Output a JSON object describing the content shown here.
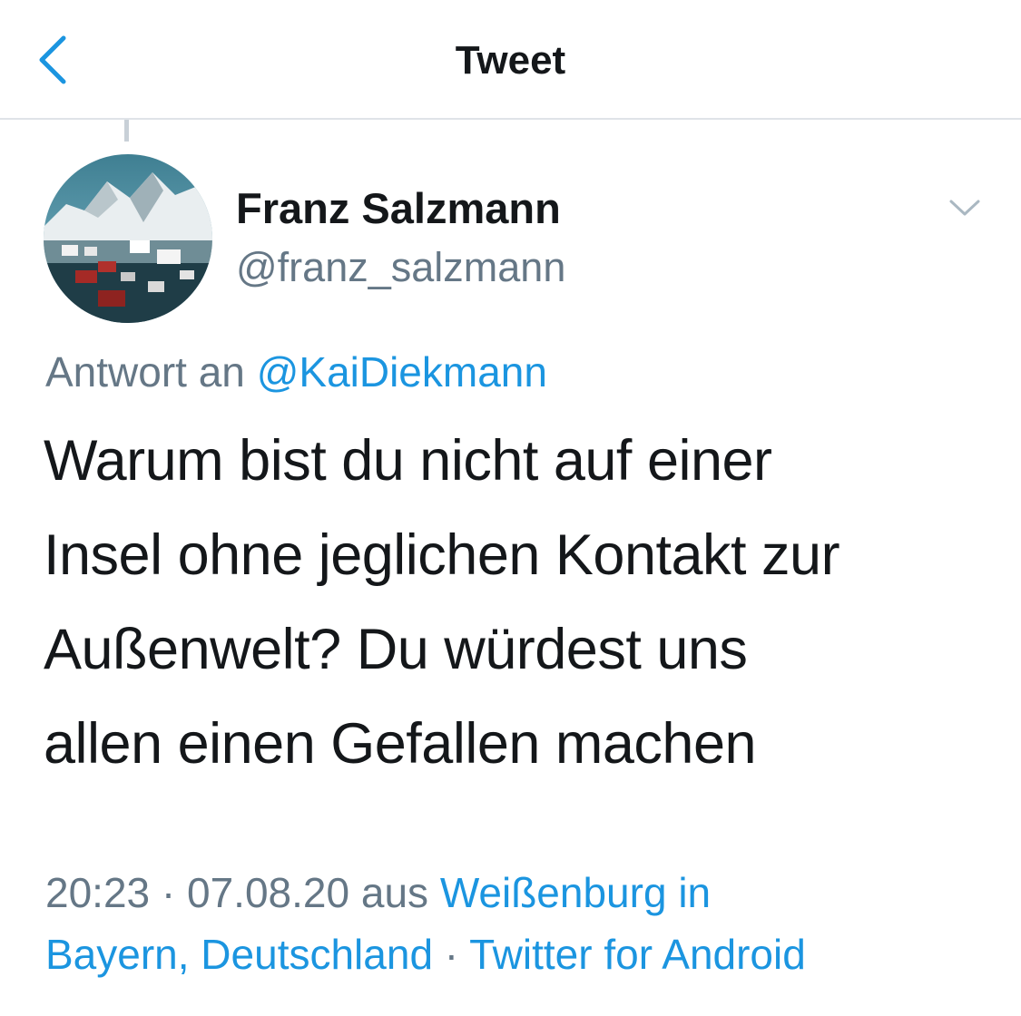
{
  "nav": {
    "title": "Tweet",
    "back_icon": "chevron-left-icon",
    "accent_color": "#1b95e0"
  },
  "tweet": {
    "author": {
      "display_name": "Franz Salzmann",
      "handle": "@franz_salzmann",
      "avatar": "avatar-mountain-village-photo"
    },
    "more_icon": "chevron-down-icon",
    "reply_to": {
      "prefix": "Antwort an",
      "mention": "@KaiDiekmann"
    },
    "text_lines": [
      "Warum bist du nicht auf einer",
      "Insel ohne jeglichen Kontakt zur",
      "Außenwelt? Du würdest uns",
      "allen einen Gefallen machen"
    ],
    "meta": {
      "time": "20:23",
      "sep1": " · ",
      "date": "07.08.20",
      "from_word": " aus ",
      "location_part1": "Weißenburg in",
      "location_part2": "Bayern, Deutschland",
      "sep2": " · ",
      "source": "Twitter for Android"
    }
  }
}
